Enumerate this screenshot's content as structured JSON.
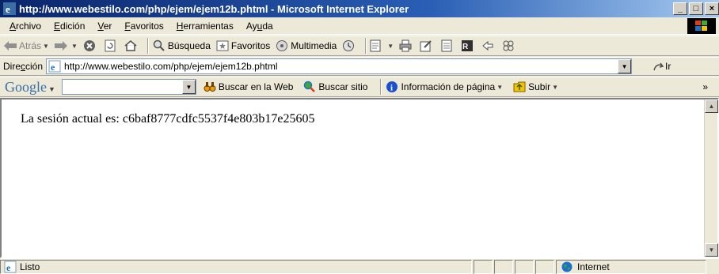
{
  "window": {
    "title": "http://www.webestilo.com/php/ejem/ejem12b.phtml - Microsoft Internet Explorer",
    "minimize_label": "_",
    "maximize_label": "□",
    "close_label": "×"
  },
  "menu": {
    "items": [
      {
        "pre": "",
        "key": "A",
        "post": "rchivo"
      },
      {
        "pre": "",
        "key": "E",
        "post": "dición"
      },
      {
        "pre": "",
        "key": "V",
        "post": "er"
      },
      {
        "pre": "",
        "key": "F",
        "post": "avoritos"
      },
      {
        "pre": "",
        "key": "H",
        "post": "erramientas"
      },
      {
        "pre": "Ay",
        "key": "u",
        "post": "da"
      }
    ]
  },
  "toolbar": {
    "back_label": "Atrás",
    "search_label": "Búsqueda",
    "favorites_label": "Favoritos",
    "multimedia_label": "Multimedia"
  },
  "address": {
    "label_pre": "Dire",
    "label_key": "c",
    "label_post": "ción",
    "url": "http://www.webestilo.com/php/ejem/ejem12b.phtml",
    "go_label": "Ir"
  },
  "google": {
    "logo": "Google",
    "search_value": "",
    "search_web_label": "Buscar en la Web",
    "search_site_label": "Buscar sitio",
    "page_info_label": "Información de página",
    "up_label": "Subir"
  },
  "content": {
    "text": "La sesión actual es: c6baf8777cdfc5537f4e803b17e25605"
  },
  "status": {
    "text": "Listo",
    "zone": "Internet"
  }
}
